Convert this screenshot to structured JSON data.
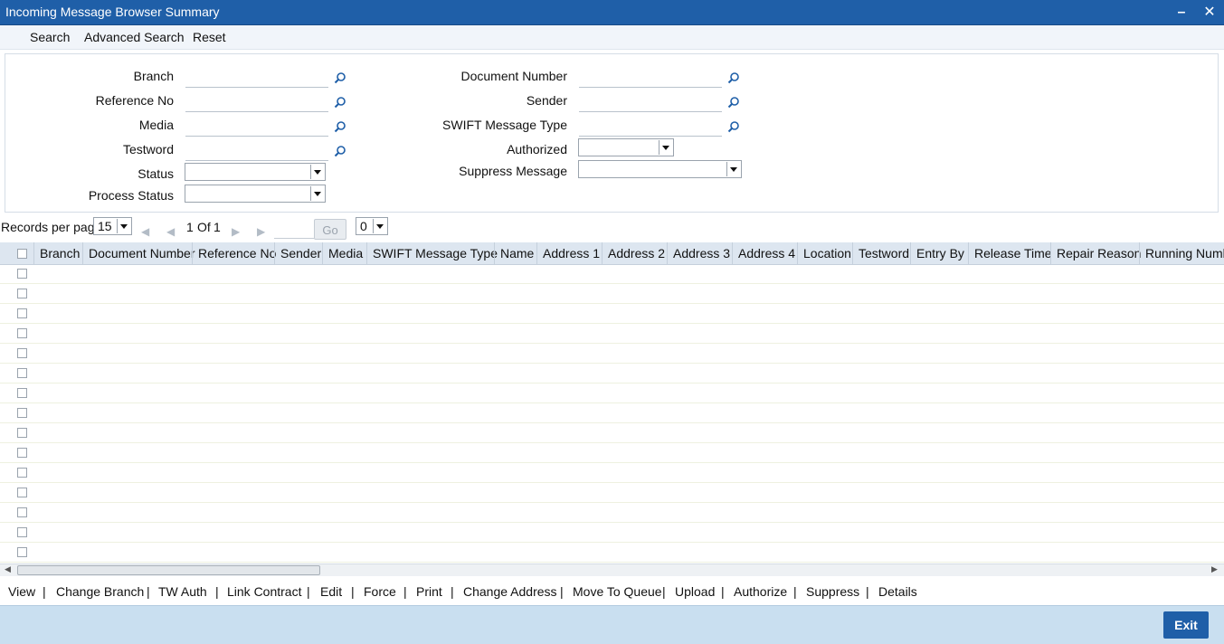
{
  "window": {
    "title": "Incoming Message Browser Summary"
  },
  "menubar": {
    "search": "Search",
    "advanced_search": "Advanced Search",
    "reset": "Reset"
  },
  "criteria": {
    "branch": "Branch",
    "reference_no": "Reference No",
    "media": "Media",
    "testword": "Testword",
    "status": "Status",
    "process_status": "Process Status",
    "document_number": "Document Number",
    "sender": "Sender",
    "swift_message_type": "SWIFT Message Type",
    "authorized": "Authorized",
    "suppress_message": "Suppress Message"
  },
  "pager": {
    "records_per_page_label": "Records per page",
    "records_per_page_value": "15",
    "page_current": "1",
    "of_label": "Of",
    "page_total": "1",
    "go_label": "Go",
    "extra_select_value": "0"
  },
  "grid": {
    "columns": [
      "Branch",
      "Document Number",
      "Reference No",
      "Sender",
      "Media",
      "SWIFT Message Type",
      "Name",
      "Address 1",
      "Address 2",
      "Address 3",
      "Address 4",
      "Location",
      "Testword",
      "Entry By",
      "Release Time",
      "Repair Reason",
      "Running Number"
    ]
  },
  "actions": [
    "View",
    "Change Branch",
    "TW Auth",
    "Link Contract",
    "Edit",
    "Force",
    "Print",
    "Change Address",
    "Move To Queue",
    "Upload",
    "Authorize",
    "Suppress",
    "Details"
  ],
  "footer": {
    "exit_label": "Exit"
  },
  "colors": {
    "titlebar": "#1f5fa8",
    "footer": "#c9dff0",
    "grid_header": "#dde6f0"
  },
  "icons": {
    "lookup": "magnifier-icon",
    "minimize": "minimize-icon",
    "close": "close-icon"
  }
}
